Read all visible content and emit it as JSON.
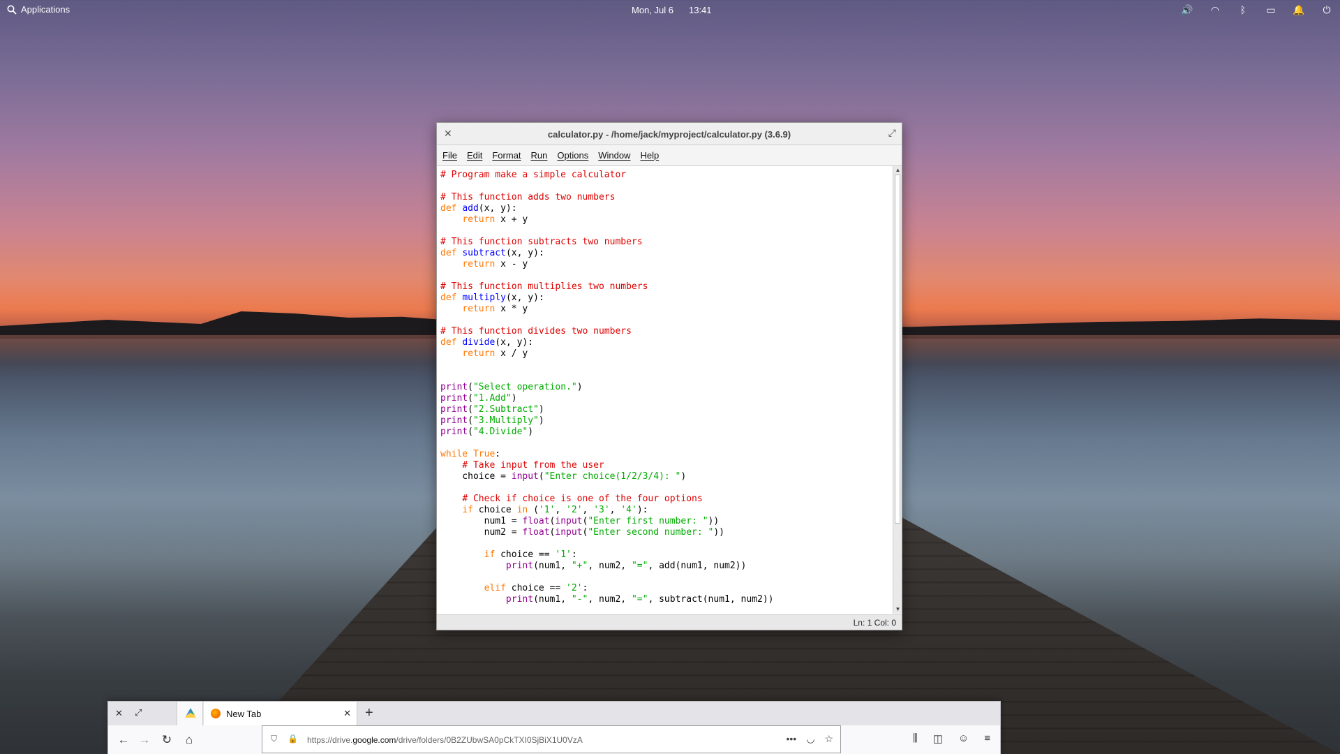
{
  "top_panel": {
    "applications_label": "Applications",
    "date": "Mon, Jul 6",
    "time": "13:41"
  },
  "idle_window": {
    "title": "calculator.py - /home/jack/myproject/calculator.py (3.6.9)",
    "menu": [
      "File",
      "Edit",
      "Format",
      "Run",
      "Options",
      "Window",
      "Help"
    ],
    "status": "Ln: 1   Col: 0"
  },
  "firefox": {
    "tab_label": "New Tab",
    "url_prefix": "https://drive.",
    "url_domain": "google.com",
    "url_path": "/drive/folders/0B2ZUbwSA0pCkTXI0SjBiX1U0VzA"
  }
}
